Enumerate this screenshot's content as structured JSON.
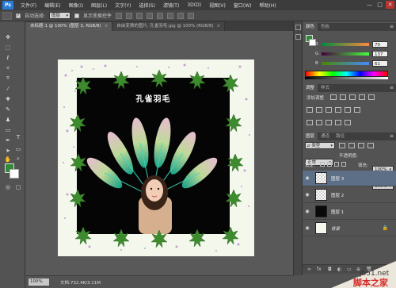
{
  "app": {
    "logo": "Ps"
  },
  "menu": [
    "文件(F)",
    "编辑(E)",
    "图像(I)",
    "图层(L)",
    "文字(Y)",
    "选择(S)",
    "滤镜(T)",
    "3D(D)",
    "视图(V)",
    "窗口(W)",
    "帮助(H)"
  ],
  "window_controls": {
    "minimize": "—",
    "maximize": "□",
    "close": "✕"
  },
  "options": {
    "auto_select_label": "自动选择:",
    "auto_select_value": "图层",
    "show_transform_label": "显示变换控件"
  },
  "tabs": [
    {
      "label": "未标题-1 @ 100% (图层 3, RGB/8)",
      "close": "×"
    },
    {
      "label": "自由变换的图片, 孔雀羽毛.jpg @ 100% (RGB/8)",
      "close": "×"
    }
  ],
  "canvas": {
    "title": "孔雀羽毛"
  },
  "status": {
    "zoom": "100%",
    "doc_info": "文档:732.4K/3.11M"
  },
  "color_panel": {
    "tabs": [
      "颜色",
      "色板"
    ],
    "R": {
      "label": "R",
      "value": "70"
    },
    "G": {
      "label": "G",
      "value": "137"
    },
    "B": {
      "label": "B",
      "value": "61"
    },
    "accent": "#2f8a3a"
  },
  "adjust_panel": {
    "tabs": [
      "调整",
      "样式"
    ],
    "add_label": "添加调整"
  },
  "layers_panel": {
    "tabs": [
      "图层",
      "通道",
      "路径"
    ],
    "kind_label": "ρ 类型",
    "blend_mode": "正常",
    "opacity_label": "不透明度:",
    "opacity_value": "100%",
    "lock_label": "锁定:",
    "fill_label": "填充:",
    "fill_value": "100%",
    "layers": [
      {
        "name": "图层 3",
        "selected": true
      },
      {
        "name": "图层 2",
        "selected": false
      },
      {
        "name": "图层 1",
        "selected": false
      },
      {
        "name": "背景",
        "selected": false
      }
    ]
  },
  "watermark": {
    "site": "jb51.net",
    "text": "脚本之家"
  },
  "colors": {
    "menubar": "#3c3c3c",
    "panel": "#535353",
    "selected_layer": "#5d6f86",
    "leaf": "#3e8a2e"
  }
}
